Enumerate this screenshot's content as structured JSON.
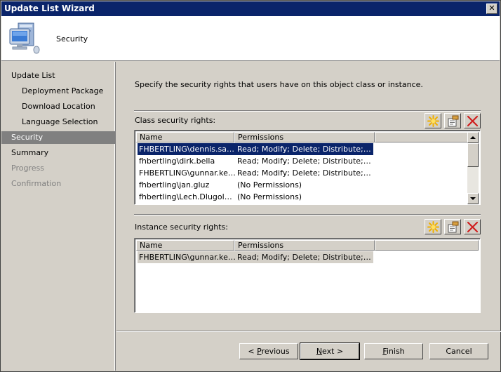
{
  "window": {
    "title": "Update List Wizard",
    "close_glyph": "✕"
  },
  "header": {
    "title": "Security",
    "icon": "computer-icon"
  },
  "sidebar": {
    "items": [
      {
        "label": "Update List",
        "indent": false,
        "state": "normal"
      },
      {
        "label": "Deployment Package",
        "indent": true,
        "state": "normal"
      },
      {
        "label": "Download Location",
        "indent": true,
        "state": "normal"
      },
      {
        "label": "Language Selection",
        "indent": true,
        "state": "normal"
      },
      {
        "label": "Security",
        "indent": false,
        "state": "selected"
      },
      {
        "label": "Summary",
        "indent": false,
        "state": "normal"
      },
      {
        "label": "Progress",
        "indent": false,
        "state": "disabled"
      },
      {
        "label": "Confirmation",
        "indent": false,
        "state": "disabled"
      }
    ]
  },
  "content": {
    "instruction": "Specify the security rights that users have on this object class or instance.",
    "class_rights": {
      "label": "Class security rights:",
      "columns": [
        "Name",
        "Permissions"
      ],
      "rows": [
        {
          "name": "FHBERTLING\\dennis.sachs",
          "permissions": "Read; Modify; Delete; Distribute; Ad...",
          "selected": true
        },
        {
          "name": "fhbertling\\dirk.bella",
          "permissions": "Read; Modify; Delete; Distribute; Ad...",
          "selected": false
        },
        {
          "name": "FHBERTLING\\gunnar.ken...",
          "permissions": "Read; Modify; Delete; Distribute; Ad...",
          "selected": false
        },
        {
          "name": "fhbertling\\jan.gluz",
          "permissions": "(No Permissions)",
          "selected": false
        },
        {
          "name": "fhbertling\\Lech.Dlugolecki",
          "permissions": "(No Permissions)",
          "selected": false
        }
      ]
    },
    "instance_rights": {
      "label": "Instance security rights:",
      "columns": [
        "Name",
        "Permissions"
      ],
      "rows": [
        {
          "name": "FHBERTLING\\gunnar.ken...",
          "permissions": "Read; Modify; Delete; Distribute; Ne...",
          "selected": true
        }
      ]
    },
    "toolbar_icons": [
      "new-icon",
      "properties-icon",
      "delete-icon"
    ]
  },
  "buttons": {
    "previous": {
      "mnemonic": "P",
      "rest": "revious",
      "prefix": "< "
    },
    "next": {
      "mnemonic": "N",
      "rest": "ext >",
      "prefix": ""
    },
    "finish": {
      "mnemonic": "F",
      "rest": "inish",
      "prefix": ""
    },
    "cancel": {
      "label": "Cancel"
    }
  },
  "colors": {
    "selection": "#0a246a",
    "titlebar": "#0a246a",
    "dialog": "#d4d0c8"
  }
}
